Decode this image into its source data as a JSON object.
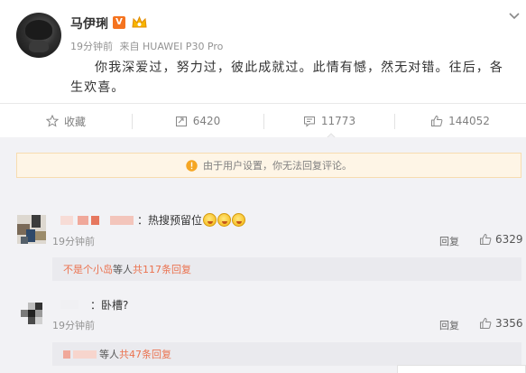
{
  "post": {
    "username": "马伊琍",
    "verified_badge": "V",
    "time": "19分钟前",
    "source": "来自 HUAWEI P30 Pro",
    "text": "你我深爱过，努力过，彼此成就过。此情有憾，然无对错。往后，各生欢喜。",
    "icons": {
      "expand": "chevron-down-icon",
      "crown": "crown-icon"
    }
  },
  "actions": {
    "favorite": {
      "label": "收藏",
      "icon": "star-icon"
    },
    "repost": {
      "count": "6420",
      "icon": "repost-icon"
    },
    "comment": {
      "count": "11773",
      "icon": "comment-icon"
    },
    "like": {
      "count": "144052",
      "icon": "thumbs-up-icon"
    }
  },
  "notice": {
    "text": "由于用户设置，你无法回复评论。",
    "icon": "warning-icon"
  },
  "comments": [
    {
      "text": "：热搜预留位",
      "emoji_count": 3,
      "time": "19分钟前",
      "reply_label": "回复",
      "likes": "6329",
      "sub": {
        "lead": "不是个小岛",
        "middle": " 等人 ",
        "link": "共117条回复"
      }
    },
    {
      "text": "：卧槽?",
      "time": "19分钟前",
      "reply_label": "回复",
      "likes": "3356",
      "sub": {
        "middle": "等人 ",
        "link": "共47条回复"
      }
    }
  ],
  "colors": {
    "accent": "#eb7350",
    "verified": "#f5731f",
    "notice_bg": "#fef5e6",
    "comment_bg": "#f2f2f5"
  }
}
